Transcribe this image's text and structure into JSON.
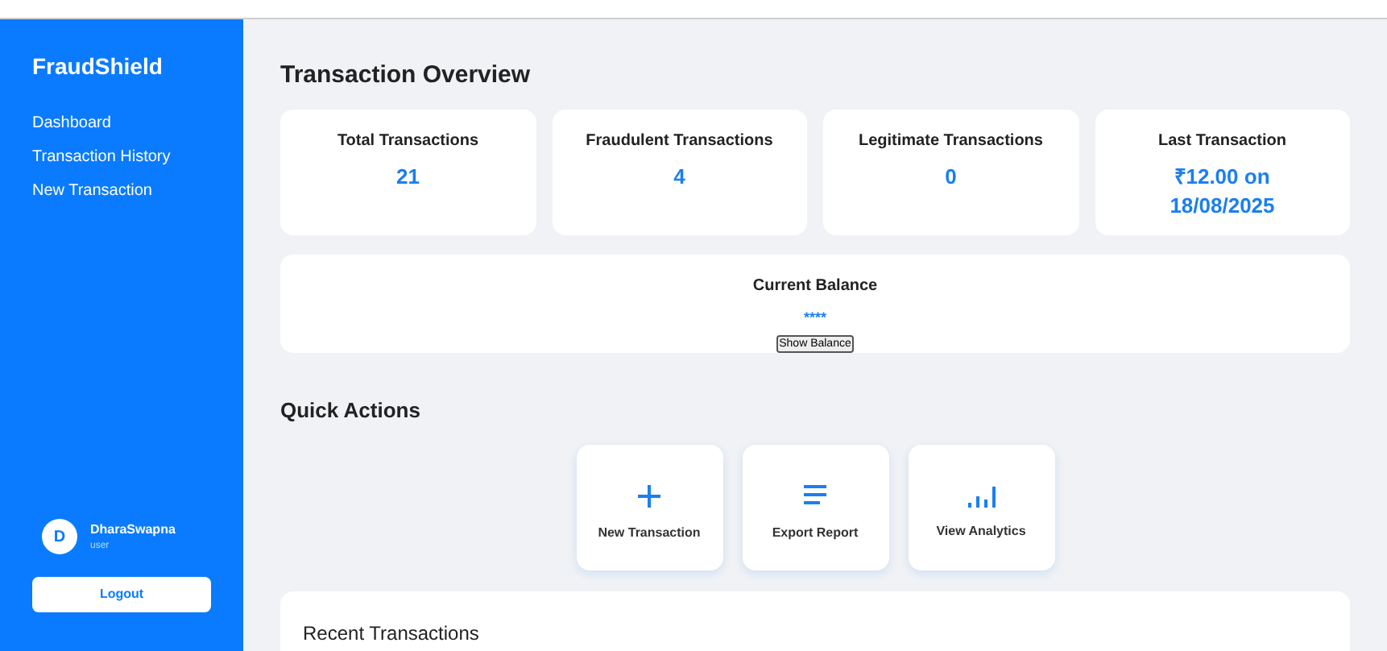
{
  "sidebar": {
    "brand": "FraudShield",
    "items": [
      "Dashboard",
      "Transaction History",
      "New Transaction"
    ],
    "user": {
      "initial": "D",
      "name": "DharaSwapna",
      "role": "user"
    },
    "logout": "Logout"
  },
  "overview": {
    "title": "Transaction Overview",
    "stats": [
      {
        "label": "Total Transactions",
        "value": "21"
      },
      {
        "label": "Fraudulent Transactions",
        "value": "4"
      },
      {
        "label": "Legitimate Transactions",
        "value": "0"
      },
      {
        "label": "Last Transaction",
        "value": "₹12.00 on 18/08/2025"
      }
    ]
  },
  "balance": {
    "label": "Current Balance",
    "value": "****",
    "button": "Show Balance"
  },
  "quick_actions": {
    "title": "Quick Actions",
    "items": [
      {
        "kind": "plus",
        "label": "New Transaction"
      },
      {
        "kind": "lines",
        "label": "Export Report"
      },
      {
        "kind": "bars",
        "label": "View Analytics"
      }
    ]
  },
  "recent": {
    "title": "Recent Transactions"
  }
}
